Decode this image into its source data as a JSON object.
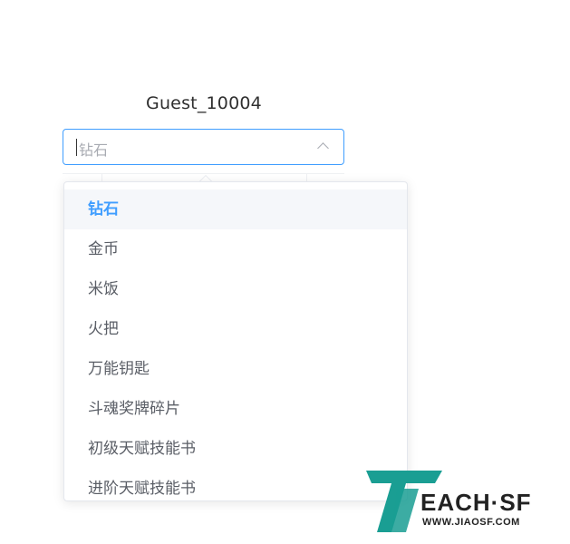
{
  "user": {
    "name": "Guest_10004"
  },
  "select": {
    "placeholder": "钻石",
    "open": true
  },
  "dropdown": {
    "selected_index": 0,
    "options": [
      "钻石",
      "金币",
      "米饭",
      "火把",
      "万能钥匙",
      "斗魂奖牌碎片",
      "初级天赋技能书",
      "进阶天赋技能书"
    ]
  },
  "watermark": {
    "brand": "EACH·SF",
    "url": "WWW.JIAOSF.COM"
  },
  "colors": {
    "accent": "#409eff",
    "logo": "#1a9e93",
    "option_text": "#5a5e66"
  }
}
